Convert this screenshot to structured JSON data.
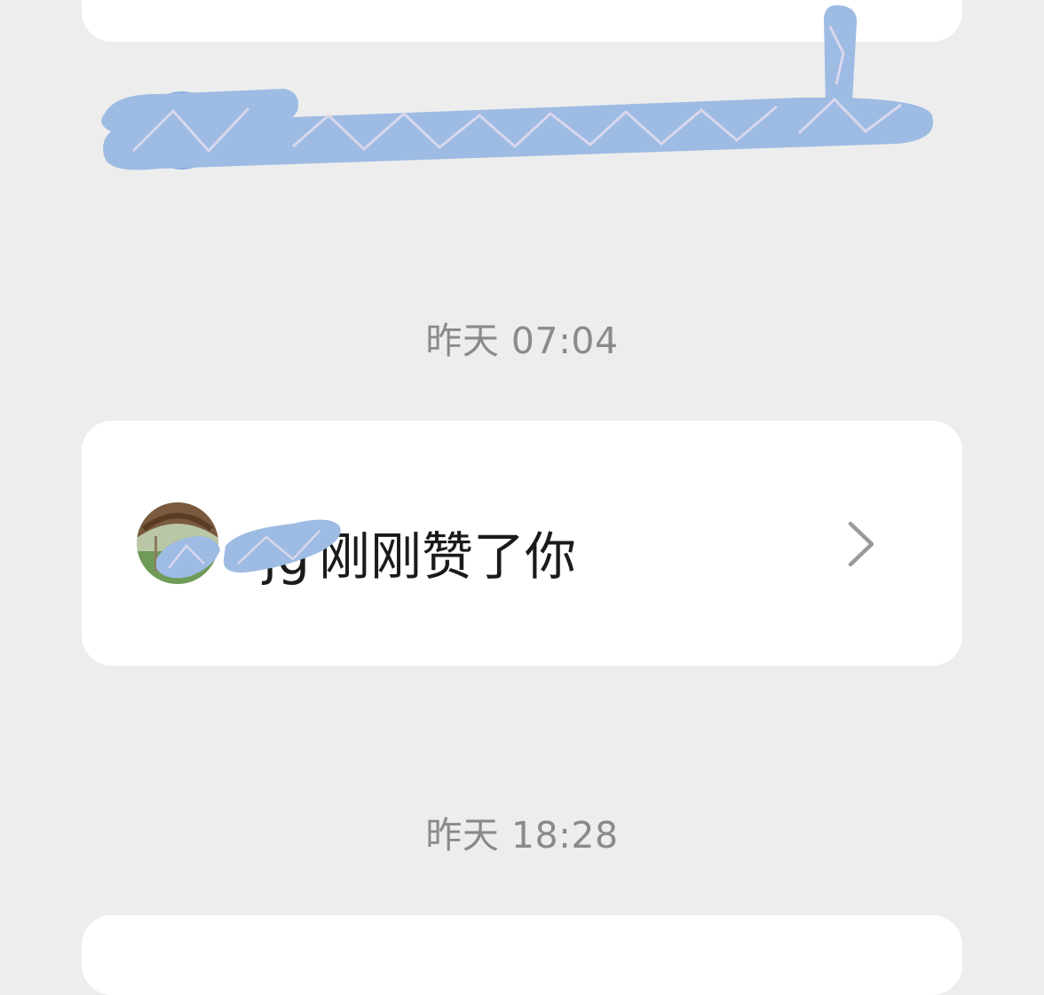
{
  "timeline": {
    "entries": [
      {
        "timestamp": "昨天 07:04",
        "notification": {
          "name_visible_fragment": "jg",
          "action_text": "刚刚赞了你"
        }
      },
      {
        "timestamp": "昨天 18:28"
      }
    ]
  },
  "colors": {
    "page_background": "#ededed",
    "card_background": "#ffffff",
    "timestamp_text": "#8a8a8a",
    "primary_text": "#1b1b1b",
    "chevron": "#9a9a9a",
    "redaction": "#9dbbe3"
  },
  "icons": {
    "chevron": "chevron-right-icon",
    "avatar": "user-avatar"
  }
}
